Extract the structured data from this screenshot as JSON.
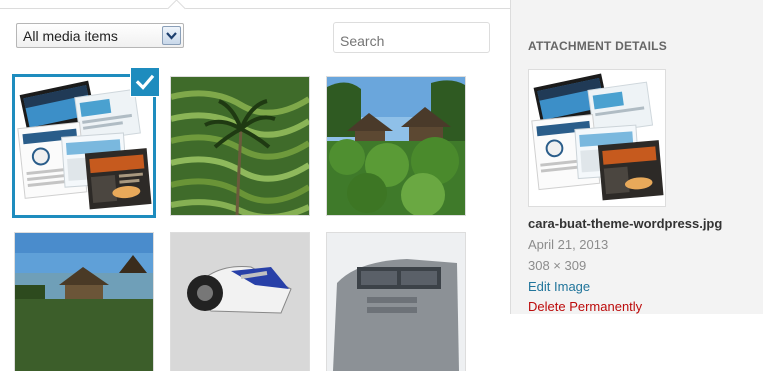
{
  "toolbar": {
    "filter_value": "All media items",
    "search_placeholder": "Search"
  },
  "media_grid": {
    "items": [
      {
        "image": "website-design-collage",
        "selected": true
      },
      {
        "image": "rice-terraces-palm-tree",
        "selected": false
      },
      {
        "image": "thatched-huts-greenery",
        "selected": false
      },
      {
        "image": "lake-temple-thatched-roofs",
        "selected": false
      },
      {
        "image": "sport-motorcycle",
        "selected": false
      },
      {
        "image": "grey-truck-front",
        "selected": false
      }
    ]
  },
  "details": {
    "heading": "ATTACHMENT DETAILS",
    "filename": "cara-buat-theme-wordpress.jpg",
    "date": "April 21, 2013",
    "dimensions": "308 × 309",
    "edit_label": "Edit Image",
    "delete_label": "Delete Permanently"
  },
  "colors": {
    "selection_blue": "#1e8cbe",
    "link_blue": "#21759b",
    "delete_red": "#bc0b0b"
  }
}
